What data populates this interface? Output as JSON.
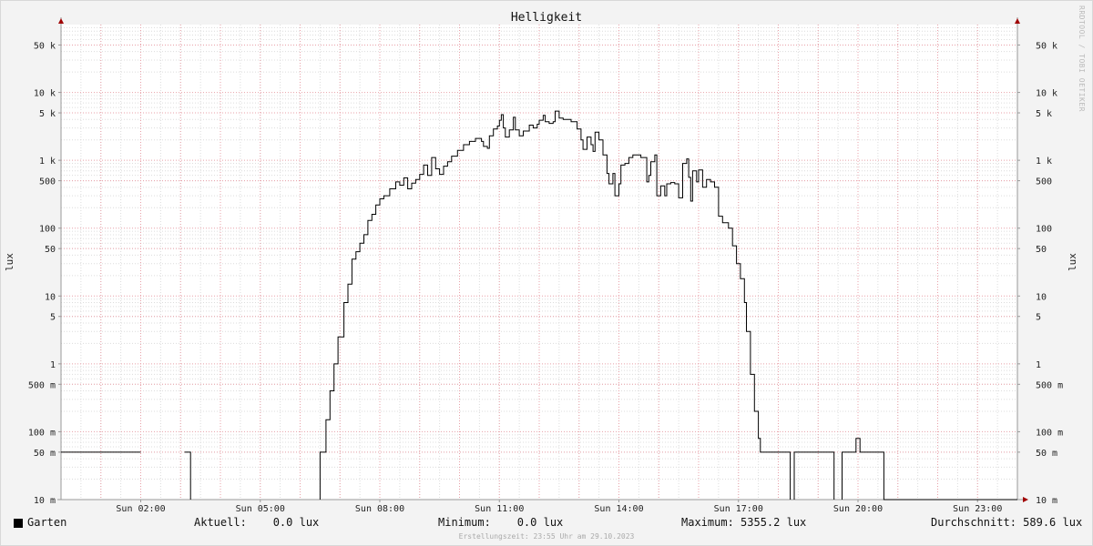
{
  "chart_data": {
    "type": "line",
    "title": "Helligkeit",
    "ylabel": "lux",
    "scale": "log",
    "ylim": [
      0.01,
      100000
    ],
    "xlim_hours": [
      0,
      24
    ],
    "x_ticks": [
      {
        "h": 2,
        "label": "Sun 02:00"
      },
      {
        "h": 5,
        "label": "Sun 05:00"
      },
      {
        "h": 8,
        "label": "Sun 08:00"
      },
      {
        "h": 11,
        "label": "Sun 11:00"
      },
      {
        "h": 14,
        "label": "Sun 14:00"
      },
      {
        "h": 17,
        "label": "Sun 17:00"
      },
      {
        "h": 20,
        "label": "Sun 20:00"
      },
      {
        "h": 23,
        "label": "Sun 23:00"
      }
    ],
    "y_ticks": [
      {
        "v": 0.01,
        "label": "10 m"
      },
      {
        "v": 0.05,
        "label": "50 m"
      },
      {
        "v": 0.1,
        "label": "100 m"
      },
      {
        "v": 0.5,
        "label": "500 m"
      },
      {
        "v": 1,
        "label": "1"
      },
      {
        "v": 5,
        "label": "5"
      },
      {
        "v": 10,
        "label": "10"
      },
      {
        "v": 50,
        "label": "50"
      },
      {
        "v": 100,
        "label": "100"
      },
      {
        "v": 500,
        "label": "500"
      },
      {
        "v": 1000,
        "label": "1 k"
      },
      {
        "v": 5000,
        "label": "5 k"
      },
      {
        "v": 10000,
        "label": "10 k"
      },
      {
        "v": 50000,
        "label": "50 k"
      }
    ],
    "grid": true,
    "series": [
      {
        "name": "Garten",
        "color": "#000000",
        "segments": [
          [
            [
              0.0,
              0.05
            ],
            [
              2.0,
              0.05
            ]
          ],
          [
            [
              3.1,
              0.05
            ],
            [
              3.25,
              0.05
            ],
            [
              3.25,
              0.01
            ]
          ],
          [
            [
              6.5,
              0.01
            ],
            [
              6.5,
              0.05
            ],
            [
              6.65,
              0.05
            ],
            [
              6.65,
              0.15
            ],
            [
              6.75,
              0.15
            ],
            [
              6.75,
              0.4
            ],
            [
              6.85,
              0.4
            ],
            [
              6.85,
              1
            ],
            [
              6.95,
              1
            ],
            [
              6.95,
              2.5
            ],
            [
              7.1,
              2.5
            ],
            [
              7.1,
              8
            ],
            [
              7.2,
              8
            ],
            [
              7.2,
              15
            ],
            [
              7.3,
              15
            ],
            [
              7.3,
              35
            ],
            [
              7.4,
              35
            ],
            [
              7.4,
              45
            ],
            [
              7.5,
              45
            ],
            [
              7.5,
              60
            ],
            [
              7.6,
              60
            ],
            [
              7.6,
              80
            ],
            [
              7.7,
              80
            ],
            [
              7.7,
              130
            ],
            [
              7.8,
              130
            ],
            [
              7.8,
              160
            ],
            [
              7.9,
              160
            ],
            [
              7.9,
              220
            ],
            [
              8.0,
              220
            ],
            [
              8.0,
              270
            ],
            [
              8.1,
              270
            ],
            [
              8.1,
              300
            ],
            [
              8.25,
              300
            ],
            [
              8.25,
              380
            ],
            [
              8.4,
              380
            ],
            [
              8.4,
              480
            ],
            [
              8.5,
              480
            ],
            [
              8.5,
              430
            ],
            [
              8.6,
              430
            ],
            [
              8.6,
              550
            ],
            [
              8.7,
              550
            ],
            [
              8.7,
              380
            ],
            [
              8.8,
              380
            ],
            [
              8.8,
              460
            ],
            [
              8.9,
              460
            ],
            [
              8.9,
              520
            ],
            [
              9.0,
              520
            ],
            [
              9.0,
              620
            ],
            [
              9.1,
              620
            ],
            [
              9.1,
              850
            ],
            [
              9.2,
              850
            ],
            [
              9.2,
              600
            ],
            [
              9.3,
              600
            ],
            [
              9.3,
              1100
            ],
            [
              9.4,
              1100
            ],
            [
              9.4,
              750
            ],
            [
              9.5,
              750
            ],
            [
              9.5,
              620
            ],
            [
              9.6,
              620
            ],
            [
              9.6,
              820
            ],
            [
              9.7,
              820
            ],
            [
              9.7,
              950
            ],
            [
              9.8,
              950
            ],
            [
              9.8,
              1150
            ],
            [
              9.95,
              1150
            ],
            [
              9.95,
              1400
            ],
            [
              10.1,
              1400
            ],
            [
              10.1,
              1700
            ],
            [
              10.25,
              1700
            ],
            [
              10.25,
              1900
            ],
            [
              10.4,
              1900
            ],
            [
              10.4,
              2100
            ],
            [
              10.55,
              2100
            ],
            [
              10.55,
              1900
            ],
            [
              10.6,
              1900
            ],
            [
              10.6,
              1600
            ],
            [
              10.7,
              1600
            ],
            [
              10.7,
              1500
            ],
            [
              10.75,
              1500
            ],
            [
              10.75,
              2300
            ],
            [
              10.85,
              2300
            ],
            [
              10.85,
              2900
            ],
            [
              10.95,
              2900
            ],
            [
              10.95,
              3200
            ],
            [
              11.0,
              3200
            ],
            [
              11.0,
              3900
            ],
            [
              11.05,
              3900
            ],
            [
              11.05,
              4700
            ],
            [
              11.1,
              4700
            ],
            [
              11.1,
              3000
            ],
            [
              11.15,
              3000
            ],
            [
              11.15,
              2200
            ],
            [
              11.25,
              2200
            ],
            [
              11.25,
              2800
            ],
            [
              11.35,
              2800
            ],
            [
              11.35,
              4300
            ],
            [
              11.4,
              4300
            ],
            [
              11.4,
              2800
            ],
            [
              11.5,
              2800
            ],
            [
              11.5,
              2300
            ],
            [
              11.6,
              2300
            ],
            [
              11.6,
              2700
            ],
            [
              11.75,
              2700
            ],
            [
              11.75,
              3300
            ],
            [
              11.85,
              3300
            ],
            [
              11.85,
              3000
            ],
            [
              11.95,
              3000
            ],
            [
              11.95,
              3400
            ],
            [
              12.0,
              3400
            ],
            [
              12.0,
              3900
            ],
            [
              12.1,
              3900
            ],
            [
              12.1,
              4600
            ],
            [
              12.15,
              4600
            ],
            [
              12.15,
              3700
            ],
            [
              12.25,
              3700
            ],
            [
              12.25,
              3500
            ],
            [
              12.35,
              3500
            ],
            [
              12.35,
              3700
            ],
            [
              12.4,
              3700
            ],
            [
              12.4,
              5300
            ],
            [
              12.5,
              5300
            ],
            [
              12.5,
              4200
            ],
            [
              12.6,
              4200
            ],
            [
              12.6,
              4000
            ],
            [
              12.8,
              4000
            ],
            [
              12.8,
              3700
            ],
            [
              12.95,
              3700
            ],
            [
              12.95,
              2900
            ],
            [
              13.05,
              2900
            ],
            [
              13.05,
              2000
            ],
            [
              13.1,
              2000
            ],
            [
              13.1,
              1450
            ],
            [
              13.2,
              1450
            ],
            [
              13.2,
              2200
            ],
            [
              13.3,
              2200
            ],
            [
              13.3,
              1700
            ],
            [
              13.35,
              1700
            ],
            [
              13.35,
              1350
            ],
            [
              13.4,
              1350
            ],
            [
              13.4,
              2600
            ],
            [
              13.5,
              2600
            ],
            [
              13.5,
              2000
            ],
            [
              13.6,
              2000
            ],
            [
              13.6,
              1200
            ],
            [
              13.7,
              1200
            ],
            [
              13.7,
              640
            ],
            [
              13.75,
              640
            ],
            [
              13.75,
              450
            ],
            [
              13.85,
              450
            ],
            [
              13.85,
              640
            ],
            [
              13.9,
              640
            ],
            [
              13.9,
              300
            ],
            [
              14.0,
              300
            ],
            [
              14.0,
              450
            ],
            [
              14.05,
              450
            ],
            [
              14.05,
              850
            ],
            [
              14.15,
              850
            ],
            [
              14.15,
              900
            ],
            [
              14.25,
              900
            ],
            [
              14.25,
              1100
            ],
            [
              14.35,
              1100
            ],
            [
              14.35,
              1200
            ],
            [
              14.55,
              1200
            ],
            [
              14.55,
              1100
            ],
            [
              14.7,
              1100
            ],
            [
              14.7,
              480
            ],
            [
              14.75,
              480
            ],
            [
              14.75,
              600
            ],
            [
              14.8,
              600
            ],
            [
              14.8,
              950
            ],
            [
              14.9,
              950
            ],
            [
              14.9,
              1200
            ],
            [
              14.95,
              1200
            ],
            [
              14.95,
              300
            ],
            [
              15.05,
              300
            ],
            [
              15.05,
              420
            ],
            [
              15.15,
              420
            ],
            [
              15.15,
              300
            ],
            [
              15.2,
              300
            ],
            [
              15.2,
              450
            ],
            [
              15.3,
              450
            ],
            [
              15.3,
              470
            ],
            [
              15.4,
              470
            ],
            [
              15.4,
              450
            ],
            [
              15.5,
              450
            ],
            [
              15.5,
              280
            ],
            [
              15.6,
              280
            ],
            [
              15.6,
              900
            ],
            [
              15.7,
              900
            ],
            [
              15.7,
              1050
            ],
            [
              15.75,
              1050
            ],
            [
              15.75,
              560
            ],
            [
              15.8,
              560
            ],
            [
              15.8,
              250
            ],
            [
              15.85,
              250
            ],
            [
              15.85,
              700
            ],
            [
              15.95,
              700
            ],
            [
              15.95,
              480
            ],
            [
              16.0,
              480
            ],
            [
              16.0,
              720
            ],
            [
              16.1,
              720
            ],
            [
              16.1,
              400
            ],
            [
              16.2,
              400
            ],
            [
              16.2,
              520
            ],
            [
              16.3,
              520
            ],
            [
              16.3,
              480
            ],
            [
              16.4,
              480
            ],
            [
              16.4,
              400
            ],
            [
              16.5,
              400
            ],
            [
              16.5,
              150
            ],
            [
              16.6,
              150
            ],
            [
              16.6,
              120
            ],
            [
              16.75,
              120
            ],
            [
              16.75,
              100
            ],
            [
              16.85,
              100
            ],
            [
              16.85,
              55
            ],
            [
              16.95,
              55
            ],
            [
              16.95,
              30
            ],
            [
              17.05,
              30
            ],
            [
              17.05,
              18
            ],
            [
              17.15,
              18
            ],
            [
              17.15,
              8
            ],
            [
              17.2,
              8
            ],
            [
              17.2,
              3
            ],
            [
              17.3,
              3
            ],
            [
              17.3,
              0.7
            ],
            [
              17.4,
              0.7
            ],
            [
              17.4,
              0.2
            ],
            [
              17.5,
              0.2
            ],
            [
              17.5,
              0.08
            ],
            [
              17.55,
              0.08
            ],
            [
              17.55,
              0.05
            ],
            [
              18.3,
              0.05
            ],
            [
              18.3,
              0.01
            ]
          ],
          [
            [
              18.4,
              0.01
            ],
            [
              18.4,
              0.05
            ],
            [
              19.4,
              0.05
            ],
            [
              19.4,
              0.01
            ]
          ],
          [
            [
              19.6,
              0.01
            ],
            [
              19.6,
              0.05
            ],
            [
              19.95,
              0.05
            ],
            [
              19.95,
              0.08
            ],
            [
              20.05,
              0.08
            ],
            [
              20.05,
              0.05
            ],
            [
              20.65,
              0.05
            ],
            [
              20.65,
              0.01
            ],
            [
              24.0,
              0.01
            ]
          ]
        ]
      }
    ]
  },
  "legend": {
    "series_name": "Garten",
    "swatch_color": "#000000"
  },
  "stats": {
    "current": "Aktuell:    0.0 lux",
    "minimum": "Minimum:    0.0 lux",
    "maximum": "Maximum: 5355.2 lux",
    "average": "Durchschnitt: 589.6 lux"
  },
  "generated": "Erstellungszeit: 23:55 Uhr am 29.10.2023",
  "watermark": "RRDTOOL / TOBI OETIKER",
  "colors": {
    "grid_major": "#e8a0a8",
    "grid_minor": "#dcdcdc",
    "axis": "#999999",
    "arrow": "#a00000",
    "plot_bg": "#ffffff"
  }
}
